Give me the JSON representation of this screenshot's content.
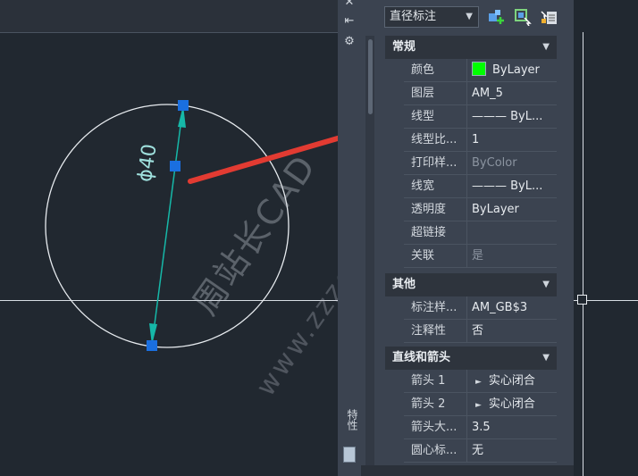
{
  "drawing": {
    "dimension_text": "ϕ40",
    "watermark": "周站长CAD",
    "watermark_url": "www.zzzcad.com",
    "colors": {
      "background": "#212830",
      "circle": "#e8ecf0",
      "dimension": "#16b8a8",
      "grip": "#1a6fe0",
      "arrow": "#e23b32"
    }
  },
  "sidebar": {
    "close_icon": "close-icon",
    "pin_icon": "pin-icon",
    "settings_icon": "gear-icon",
    "vertical_label": "特性",
    "bottom_icon": "properties-icon"
  },
  "toolbar": {
    "object_type": "直径标注",
    "quick_select_icon": "quick-select-icon",
    "select_objects_icon": "select-objects-icon",
    "toggle_pickadd_icon": "pickadd-icon"
  },
  "sections": [
    {
      "title": "常规",
      "rows": [
        {
          "key": "颜色",
          "value": "ByLayer",
          "swatch": "#00ff00"
        },
        {
          "key": "图层",
          "value": "AM_5"
        },
        {
          "key": "线型",
          "value": "——— ByL..."
        },
        {
          "key": "线型比...",
          "value": "1"
        },
        {
          "key": "打印样...",
          "value": "ByColor",
          "dim": true
        },
        {
          "key": "线宽",
          "value": "——— ByL..."
        },
        {
          "key": "透明度",
          "value": "ByLayer"
        },
        {
          "key": "超链接",
          "value": ""
        },
        {
          "key": "关联",
          "value": "是",
          "dim": true
        }
      ]
    },
    {
      "title": "其他",
      "rows": [
        {
          "key": "标注样...",
          "value": "AM_GB$3"
        },
        {
          "key": "注释性",
          "value": "否"
        }
      ]
    },
    {
      "title": "直线和箭头",
      "rows": [
        {
          "key": "箭头 1",
          "value": "实心闭合"
        },
        {
          "key": "箭头 2",
          "value": "实心闭合"
        },
        {
          "key": "箭头大...",
          "value": "3.5"
        },
        {
          "key": "圆心标...",
          "value": "无"
        }
      ]
    }
  ]
}
